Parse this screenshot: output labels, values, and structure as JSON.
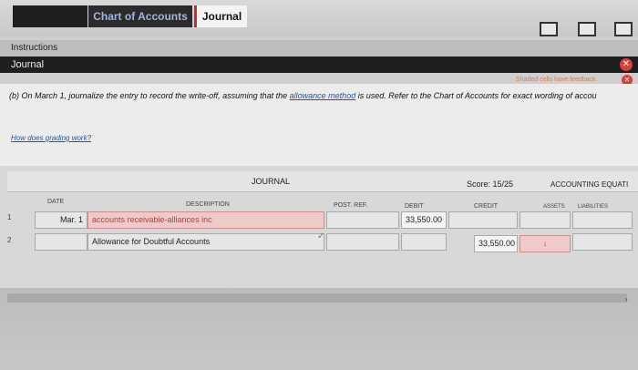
{
  "tabs": {
    "chart_of_accounts": "Chart of Accounts",
    "journal": "Journal"
  },
  "instructions_label": "Instructions",
  "journal_bar_title": "Journal",
  "feedback_note": "Shaded cells have feedback.",
  "question": {
    "prefix": "(b) On March 1, journalize the entry to record the write-off, assuming that the",
    "link": "allowance method",
    "suffix": "is used. Refer to the Chart of Accounts for exact wording of accou"
  },
  "grading_link": "How does grading work?",
  "journal": {
    "title": "JOURNAL",
    "score": "Score: 15/25",
    "equation": "ACCOUNTING EQUATI",
    "columns": {
      "date": "DATE",
      "description": "DESCRIPTION",
      "post_ref": "POST. REF.",
      "debit": "DEBIT",
      "credit": "CREDIT",
      "assets": "ASSETS",
      "liabilities": "LIABILITIES"
    },
    "rows": [
      {
        "num": "1",
        "date": "Mar. 1",
        "description": "accounts receivable-alliances inc",
        "debit": "33,550.00",
        "credit": "",
        "assets": ""
      },
      {
        "num": "2",
        "date": "",
        "description": "Allowance for Doubtful Accounts",
        "debit": "",
        "credit": "33,550.00",
        "assets": "↓"
      }
    ]
  }
}
